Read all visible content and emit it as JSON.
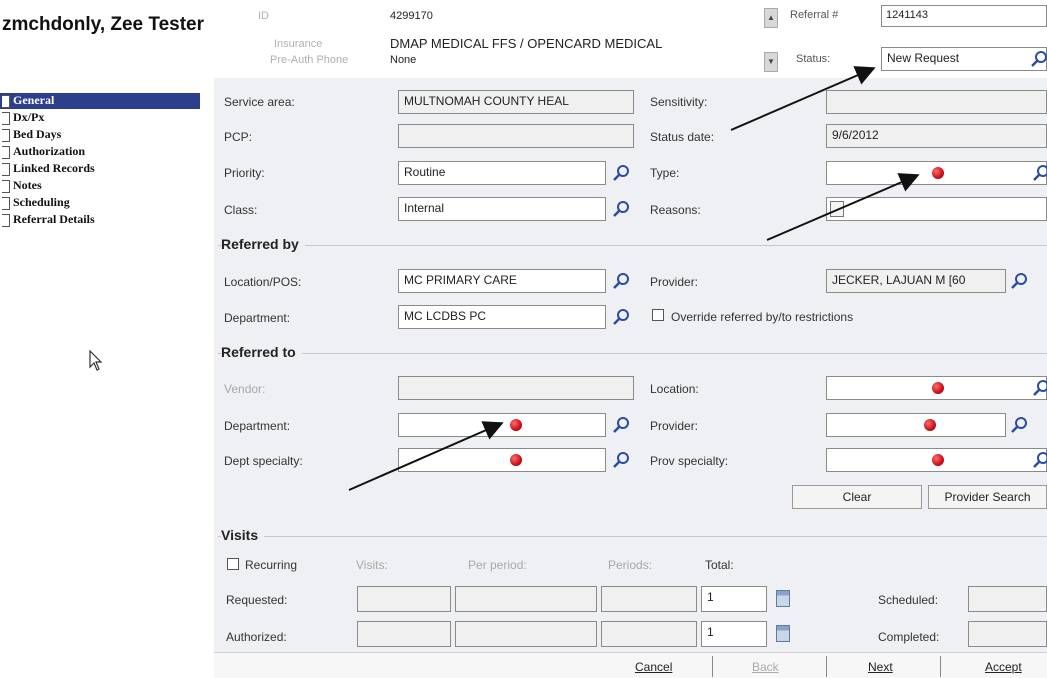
{
  "header": {
    "patient_name": "zmchdonly, Zee Tester",
    "id_label": "ID",
    "id_value": "4299170",
    "insurance_label": "Insurance",
    "insurance_value": "DMAP MEDICAL FFS / OPENCARD MEDICAL",
    "preauth_label": "Pre-Auth Phone",
    "preauth_value": "None",
    "referral_label": "Referral #",
    "referral_value": "1241143",
    "status_label": "Status:",
    "status_value": "New Request"
  },
  "sidebar": {
    "items": [
      {
        "label": "General",
        "selected": true
      },
      {
        "label": "Dx/Px"
      },
      {
        "label": "Bed Days"
      },
      {
        "label": "Authorization"
      },
      {
        "label": "Linked Records"
      },
      {
        "label": "Notes"
      },
      {
        "label": "Scheduling"
      },
      {
        "label": "Referral Details"
      }
    ]
  },
  "general": {
    "service_area_label": "Service area:",
    "service_area_value": "MULTNOMAH COUNTY HEAL",
    "pcp_label": "PCP:",
    "pcp_value": "",
    "priority_label": "Priority:",
    "priority_value": "Routine",
    "class_label": "Class:",
    "class_value": "Internal",
    "sensitivity_label": "Sensitivity:",
    "sensitivity_value": "",
    "status_date_label": "Status date:",
    "status_date_value": "9/6/2012",
    "type_label": "Type:",
    "type_value": "",
    "reasons_label": "Reasons:"
  },
  "referred_by": {
    "title": "Referred by",
    "location_label": "Location/POS:",
    "location_value": "MC PRIMARY CARE",
    "department_label": "Department:",
    "department_value": "MC LCDBS PC",
    "provider_label": "Provider:",
    "provider_value": "JECKER, LAJUAN M [60",
    "override_label": "Override referred by/to restrictions"
  },
  "referred_to": {
    "title": "Referred to",
    "vendor_label": "Vendor:",
    "department_label": "Department:",
    "dept_specialty_label": "Dept specialty:",
    "location_label": "Location:",
    "provider_label": "Provider:",
    "prov_specialty_label": "Prov specialty:",
    "clear_button": "Clear",
    "provider_search_button": "Provider Search"
  },
  "visits": {
    "title": "Visits",
    "recurring_label": "Recurring",
    "col_visits": "Visits:",
    "col_per_period": "Per period:",
    "col_periods": "Periods:",
    "col_total": "Total:",
    "requested_label": "Requested:",
    "requested_total": "1",
    "authorized_label": "Authorized:",
    "authorized_total": "1",
    "scheduled_label": "Scheduled:",
    "completed_label": "Completed:"
  },
  "footer": {
    "cancel": "Cancel",
    "back": "Back",
    "next": "Next",
    "accept": "Accept"
  },
  "colors": {
    "panel_bg": "#eef0f4",
    "required_dot": "#c8101a",
    "selected_nav": "#2b3f8c"
  },
  "icons": [
    "magnifier-icon",
    "required-indicator-icon",
    "calendar-icon",
    "checkbox-icon",
    "mouse-cursor-icon",
    "annotation-arrow"
  ]
}
